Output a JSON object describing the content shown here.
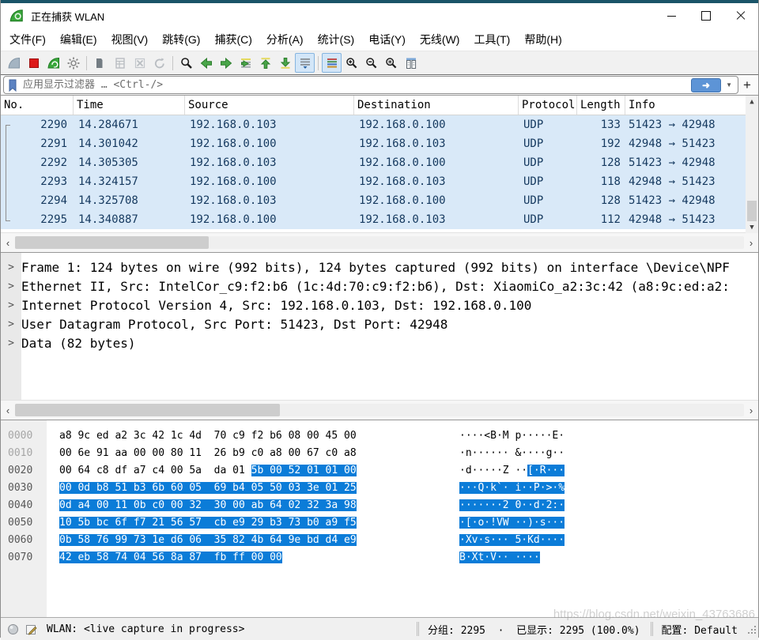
{
  "window": {
    "title": "正在捕获 WLAN",
    "accent_color": "#1a5468"
  },
  "menu": {
    "items": [
      "文件(F)",
      "编辑(E)",
      "视图(V)",
      "跳转(G)",
      "捕获(C)",
      "分析(A)",
      "统计(S)",
      "电话(Y)",
      "无线(W)",
      "工具(T)",
      "帮助(H)"
    ]
  },
  "toolbar": {
    "icons": [
      "start-capture-fin-icon",
      "stop-capture-icon",
      "restart-capture-icon",
      "capture-options-gear-icon",
      "open-file-icon",
      "save-file-icon",
      "close-file-icon",
      "reload-icon",
      "find-packet-icon",
      "go-back-icon",
      "go-forward-icon",
      "go-to-packet-icon",
      "go-to-top-icon",
      "go-to-bottom-icon",
      "auto-scroll-icon",
      "colorize-icon",
      "zoom-in-icon",
      "zoom-out-icon",
      "zoom-reset-icon",
      "resize-columns-icon"
    ],
    "active_icons": [
      "auto-scroll-icon",
      "colorize-icon"
    ]
  },
  "filter": {
    "placeholder": "应用显示过滤器 … <Ctrl-/>",
    "add_label": "+",
    "apply_arrow": "➜"
  },
  "packet_list": {
    "columns": [
      "No.",
      "Time",
      "Source",
      "Destination",
      "Protocol",
      "Length",
      "Info"
    ],
    "rows": [
      {
        "no": "2290",
        "time": "14.284671",
        "source": "192.168.0.103",
        "destination": "192.168.0.100",
        "protocol": "UDP",
        "length": "133",
        "info": "51423 → 42948"
      },
      {
        "no": "2291",
        "time": "14.301042",
        "source": "192.168.0.100",
        "destination": "192.168.0.103",
        "protocol": "UDP",
        "length": "192",
        "info": "42948 → 51423"
      },
      {
        "no": "2292",
        "time": "14.305305",
        "source": "192.168.0.103",
        "destination": "192.168.0.100",
        "protocol": "UDP",
        "length": "128",
        "info": "51423 → 42948"
      },
      {
        "no": "2293",
        "time": "14.324157",
        "source": "192.168.0.100",
        "destination": "192.168.0.103",
        "protocol": "UDP",
        "length": "118",
        "info": "42948 → 51423"
      },
      {
        "no": "2294",
        "time": "14.325708",
        "source": "192.168.0.103",
        "destination": "192.168.0.100",
        "protocol": "UDP",
        "length": "128",
        "info": "51423 → 42948"
      },
      {
        "no": "2295",
        "time": "14.340887",
        "source": "192.168.0.100",
        "destination": "192.168.0.103",
        "protocol": "UDP",
        "length": "112",
        "info": "42948 → 51423"
      }
    ],
    "row_bg": "#d9e9f8",
    "row_fg": "#15395f"
  },
  "details": {
    "lines": [
      "Frame 1: 124 bytes on wire (992 bits), 124 bytes captured (992 bits) on interface \\Device\\NPF",
      "Ethernet II, Src: IntelCor_c9:f2:b6 (1c:4d:70:c9:f2:b6), Dst: XiaomiCo_a2:3c:42 (a8:9c:ed:a2:",
      "Internet Protocol Version 4, Src: 192.168.0.103, Dst: 192.168.0.100",
      "User Datagram Protocol, Src Port: 51423, Dst Port: 42948",
      "Data (82 bytes)"
    ]
  },
  "hex_view": {
    "selection_color": "#0b7cd8",
    "rows": [
      {
        "offset": "0000",
        "dim": true,
        "hex_plain": "a8 9c ed a2 3c 42 1c 4d  70 c9 f2 b6 08 00 45 00",
        "hex_sel": "",
        "ascii_plain": "····<B·M p·····E·",
        "ascii_sel": ""
      },
      {
        "offset": "0010",
        "dim": true,
        "hex_plain": "00 6e 91 aa 00 00 80 11  26 b9 c0 a8 00 67 c0 a8",
        "hex_sel": "",
        "ascii_plain": "·n······ &····g··",
        "ascii_sel": ""
      },
      {
        "offset": "0020",
        "dim": false,
        "hex_plain": "00 64 c8 df a7 c4 00 5a  da 01 ",
        "hex_sel": "5b 00 52 01 01 00",
        "ascii_plain": "·d·····Z ··",
        "ascii_sel": "[·R···"
      },
      {
        "offset": "0030",
        "dim": false,
        "hex_plain": "",
        "hex_sel": "00 0d b8 51 b3 6b 60 05  69 b4 05 50 03 3e 01 25",
        "ascii_plain": "",
        "ascii_sel": "···Q·k`· i··P·>·%"
      },
      {
        "offset": "0040",
        "dim": false,
        "hex_plain": "",
        "hex_sel": "0d a4 00 11 0b c0 00 32  30 00 ab 64 02 32 3a 98",
        "ascii_plain": "",
        "ascii_sel": "·······2 0··d·2:·"
      },
      {
        "offset": "0050",
        "dim": false,
        "hex_plain": "",
        "hex_sel": "10 5b bc 6f f7 21 56 57  cb e9 29 b3 73 b0 a9 f5",
        "ascii_plain": "",
        "ascii_sel": "·[·o·!VW ··)·s···"
      },
      {
        "offset": "0060",
        "dim": false,
        "hex_plain": "",
        "hex_sel": "0b 58 76 99 73 1e d6 06  35 82 4b 64 9e bd d4 e9",
        "ascii_plain": "",
        "ascii_sel": "·Xv·s··· 5·Kd····"
      },
      {
        "offset": "0070",
        "dim": false,
        "hex_plain": "",
        "hex_sel": "42 eb 58 74 04 56 8a 87  fb ff 00 00",
        "ascii_plain": "",
        "ascii_sel": "B·Xt·V·· ····"
      }
    ]
  },
  "status_bar": {
    "capture_text": "WLAN: <live capture in progress>",
    "packets_text": "分组: 2295  ·  已显示: 2295 (100.0%)",
    "profile_text": "配置: Default"
  },
  "watermark": "https://blog.csdn.net/weixin_43763686"
}
